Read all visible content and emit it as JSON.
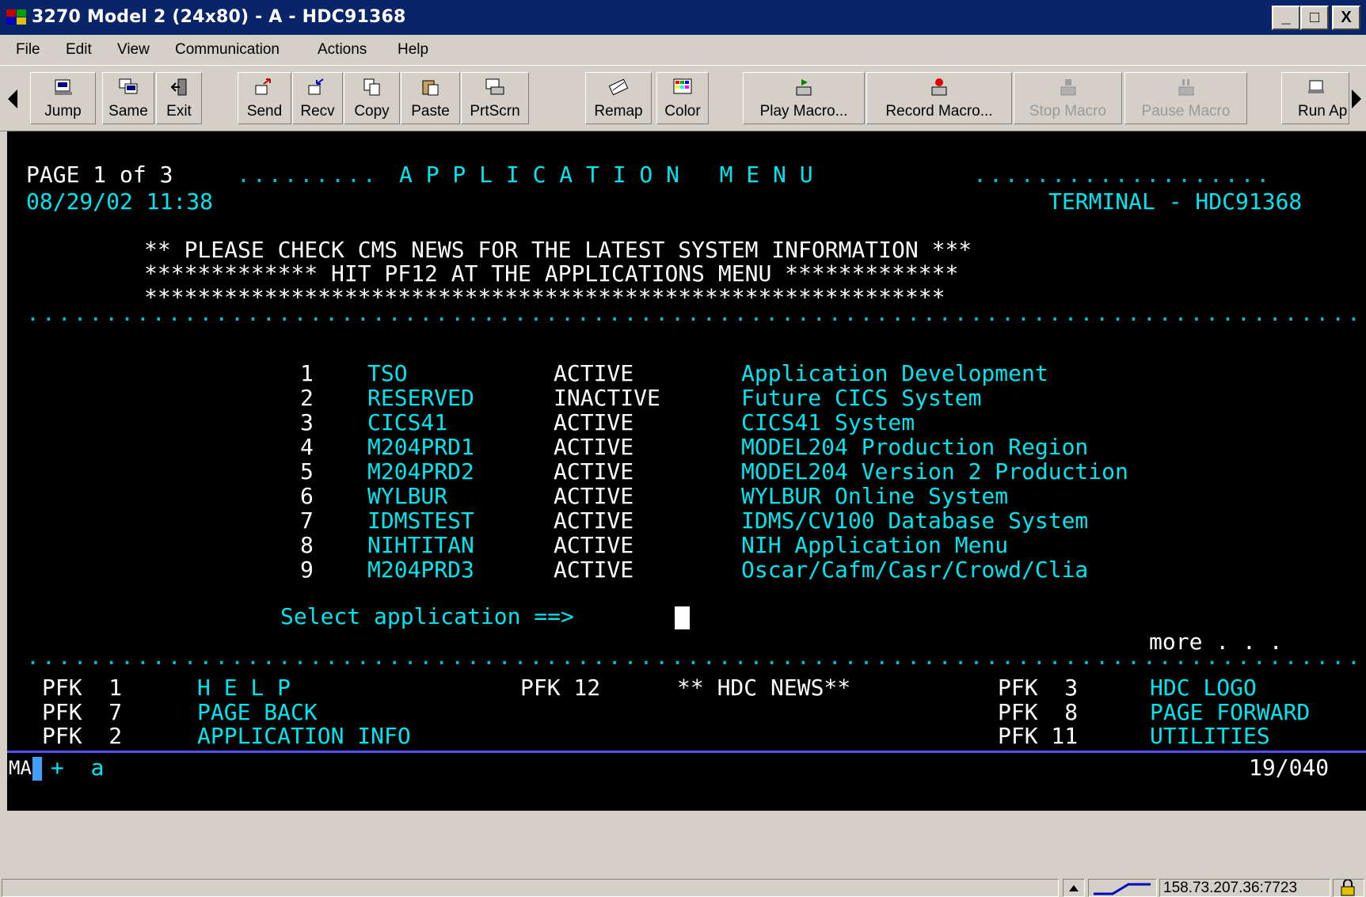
{
  "window": {
    "title": "3270 Model 2 (24x80) - A - HDC91368",
    "minimize": "_",
    "maximize": "□",
    "close": "X"
  },
  "menu": [
    "File",
    "Edit",
    "View",
    "Communication",
    "Actions",
    "Help"
  ],
  "toolbar": {
    "buttons": [
      {
        "label": "Jump",
        "icon": "jump-icon"
      },
      {
        "label": "Same",
        "icon": "same-icon"
      },
      {
        "label": "Exit",
        "icon": "exit-icon"
      },
      {
        "label": "Send",
        "icon": "send-icon"
      },
      {
        "label": "Recv",
        "icon": "receive-icon"
      },
      {
        "label": "Copy",
        "icon": "copy-icon"
      },
      {
        "label": "Paste",
        "icon": "paste-icon"
      },
      {
        "label": "PrtScrn",
        "icon": "print-screen-icon"
      },
      {
        "label": "Remap",
        "icon": "remap-icon"
      },
      {
        "label": "Color",
        "icon": "color-icon"
      },
      {
        "label": "Play Macro...",
        "icon": "play-macro-icon"
      },
      {
        "label": "Record Macro...",
        "icon": "record-macro-icon"
      },
      {
        "label": "Stop Macro",
        "icon": "stop-macro-icon"
      },
      {
        "label": "Pause Macro",
        "icon": "pause-macro-icon"
      },
      {
        "label": "Run Ap",
        "icon": "run-app-icon"
      }
    ]
  },
  "screen": {
    "header_page": "PAGE 1 of 3",
    "header_title": "A P P L I C A T I O N   M E N U",
    "datetime": "08/29/02 11:38",
    "terminal_label": "TERMINAL - HDC91368",
    "notice": [
      "** PLEASE CHECK CMS NEWS FOR THE LATEST SYSTEM INFORMATION ***",
      "************* HIT PF12 AT THE APPLICATIONS MENU *************",
      "************************************************************"
    ],
    "applications": [
      {
        "num": "1",
        "name": "TSO",
        "status": "ACTIVE",
        "desc": "Application Development"
      },
      {
        "num": "2",
        "name": "RESERVED",
        "status": "INACTIVE",
        "desc": "Future CICS System"
      },
      {
        "num": "3",
        "name": "CICS41",
        "status": "ACTIVE",
        "desc": "CICS41 System"
      },
      {
        "num": "4",
        "name": "M204PRD1",
        "status": "ACTIVE",
        "desc": "MODEL204 Production Region"
      },
      {
        "num": "5",
        "name": "M204PRD2",
        "status": "ACTIVE",
        "desc": "MODEL204 Version 2 Production"
      },
      {
        "num": "6",
        "name": "WYLBUR",
        "status": "ACTIVE",
        "desc": "WYLBUR Online System"
      },
      {
        "num": "7",
        "name": "IDMSTEST",
        "status": "ACTIVE",
        "desc": "IDMS/CV100 Database System"
      },
      {
        "num": "8",
        "name": "NIHTITAN",
        "status": "ACTIVE",
        "desc": "NIH Application Menu"
      },
      {
        "num": "9",
        "name": "M204PRD3",
        "status": "ACTIVE",
        "desc": "Oscar/Cafm/Casr/Crowd/Clia"
      }
    ],
    "prompt": "Select application ==>",
    "more": "more . . .",
    "pfkeys": [
      {
        "key": "PFK  1",
        "label": "H E L P"
      },
      {
        "key": "PFK 12",
        "label": "** HDC NEWS**"
      },
      {
        "key": "PFK  3",
        "label": "HDC LOGO"
      },
      {
        "key": "PFK  7",
        "label": "PAGE BACK"
      },
      {
        "key": "PFK  8",
        "label": "PAGE FORWARD"
      },
      {
        "key": "PFK  2",
        "label": "APPLICATION INFO"
      },
      {
        "key": "PFK 11",
        "label": "UTILITIES"
      }
    ],
    "oia_left": "MA",
    "oia_mid": "+  a",
    "oia_right": "19/040"
  },
  "status": {
    "address": "158.73.207.36:7723"
  }
}
